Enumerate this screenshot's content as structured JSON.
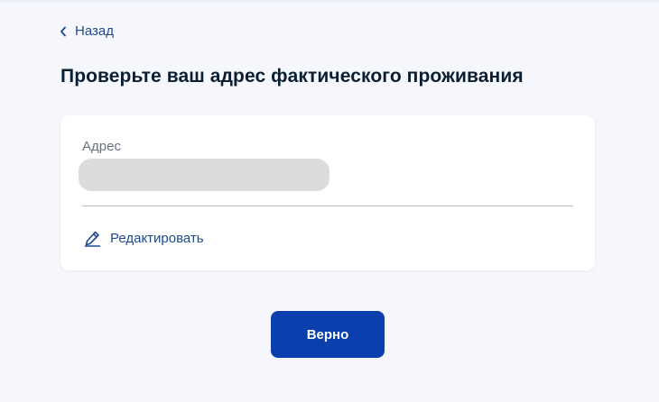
{
  "nav": {
    "back_label": "Назад",
    "back_icon": "chevron-left-icon"
  },
  "page": {
    "title": "Проверьте ваш адрес фактического проживания"
  },
  "address_card": {
    "field_label": "Адрес",
    "edit_label": "Редактировать",
    "edit_icon": "pencil-icon"
  },
  "actions": {
    "confirm_label": "Верно"
  },
  "colors": {
    "background": "#f5f7fc",
    "card": "#ffffff",
    "primary_button": "#0a3fad",
    "link": "#1d4a8f",
    "title": "#0b1f33",
    "muted_label": "#66727f",
    "redacted": "#dcdcdc"
  }
}
